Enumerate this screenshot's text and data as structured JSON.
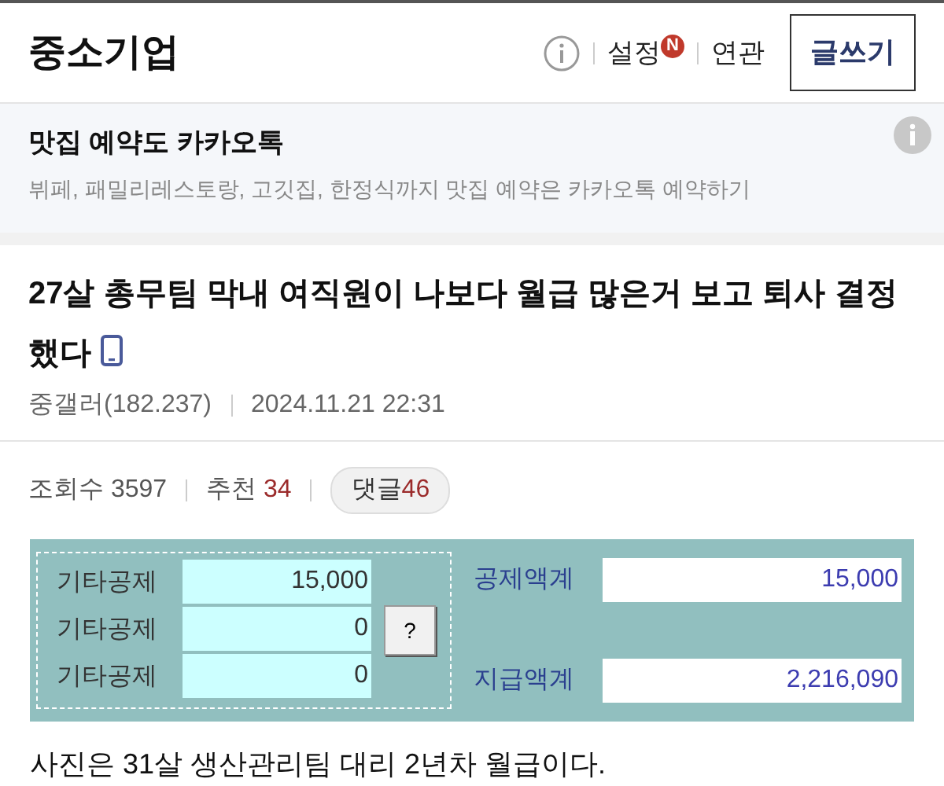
{
  "header": {
    "title": "중소기업",
    "settings": {
      "label": "설정",
      "badge": "N"
    },
    "related": "연관",
    "write_button": "글쓰기"
  },
  "ad": {
    "title": "맛집 예약도 카카오톡",
    "description": "뷔페, 패밀리레스토랑, 고깃집, 한정식까지 맛집 예약은 카카오톡 예약하기"
  },
  "post": {
    "title": "27살 총무팀 막내 여직원이 나보다 월급 많은거 보고 퇴사 결정했다",
    "author": "중갤러(182.237)",
    "date": "2024.11.21 22:31",
    "stats": {
      "views_label": "조회수",
      "views": "3597",
      "likes_label": "추천",
      "likes": "34",
      "comments_label": "댓글",
      "comments": "46"
    }
  },
  "salary_panel": {
    "deductions": [
      {
        "label": "기타공제",
        "value": "15,000"
      },
      {
        "label": "기타공제",
        "value": "0"
      },
      {
        "label": "기타공제",
        "value": "0"
      }
    ],
    "help_button": "?",
    "totals": [
      {
        "label": "공제액계",
        "value": "15,000"
      },
      {
        "label": "지급액계",
        "value": "2,216,090"
      }
    ]
  },
  "body": "사진은 31살 생산관리팀 대리 2년차 월급이다."
}
